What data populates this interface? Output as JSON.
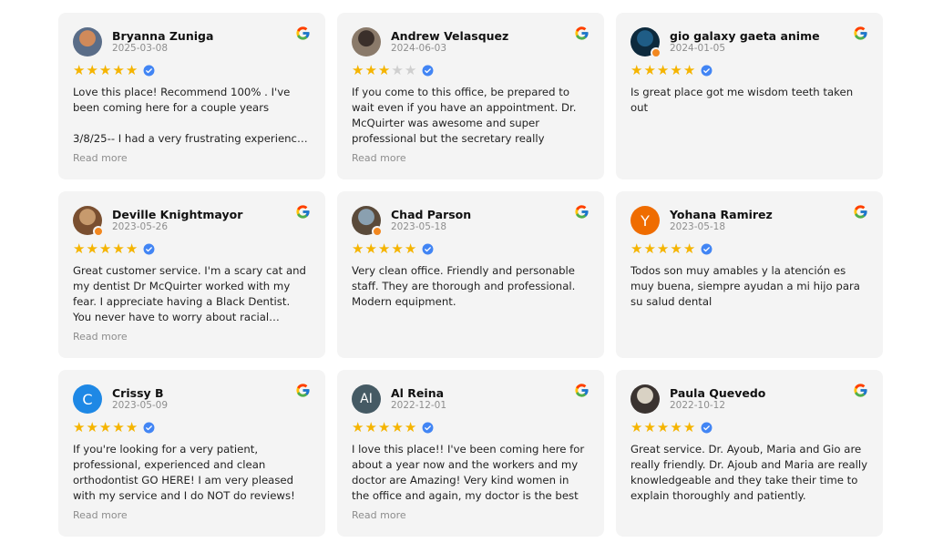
{
  "reviews": [
    {
      "name": "Bryanna Zuniga",
      "date": "2025-03-08",
      "rating": 5,
      "avatar": {
        "type": "photo",
        "color": "#d08a5a",
        "color2": "#5a6d88"
      },
      "text": "Love this place! Recommend 100% . I've been coming here for a couple years\n\n3/8/25-- I had a very frustrating experienc…",
      "more": "Read more"
    },
    {
      "name": "Andrew Velasquez",
      "date": "2024-06-03",
      "rating": 3,
      "avatar": {
        "type": "photo",
        "color": "#3a2f2a",
        "color2": "#8a7a6a"
      },
      "text": "If you come to this office, be prepared to wait even if you have an appointment. Dr. McQuirter was awesome and super professional but the secretary really needs…",
      "more": "Read more"
    },
    {
      "name": "gio galaxy gaeta anime",
      "date": "2024-01-05",
      "rating": 5,
      "avatar": {
        "type": "photo",
        "color": "#1f5d86",
        "color2": "#0d2a3d",
        "badge": true
      },
      "text": "Is great place got me wisdom teeth taken out",
      "more": ""
    },
    {
      "name": "Deville Knightmayor",
      "date": "2023-05-26",
      "rating": 5,
      "avatar": {
        "type": "photo",
        "color": "#c79a6d",
        "color2": "#7a4f30",
        "badge": true
      },
      "text": "Great customer service. I'm a scary cat and my dentist Dr McQuirter worked with my fear. I appreciate having a Black Dentist. You never have to worry about racial…",
      "more": "Read more"
    },
    {
      "name": "Chad Parson",
      "date": "2023-05-18",
      "rating": 5,
      "avatar": {
        "type": "photo",
        "color": "#8aa0b0",
        "color2": "#5a4a3a",
        "badge": true
      },
      "text": "Very clean office. Friendly and personable staff. They are thorough and professional. Modern equipment.",
      "more": ""
    },
    {
      "name": "Yohana Ramirez",
      "date": "2023-05-18",
      "rating": 5,
      "avatar": {
        "type": "letter",
        "letter": "Y",
        "color": "#ef6c00"
      },
      "text": "Todos son muy amables y la atención es muy buena, siempre ayudan a mi hijo para su salud dental",
      "more": ""
    },
    {
      "name": "Crissy B",
      "date": "2023-05-09",
      "rating": 5,
      "avatar": {
        "type": "letter",
        "letter": "C",
        "color": "#1e88e5"
      },
      "text": "If you're looking for a very patient, professional, experienced and clean orthodontist GO HERE! I am very pleased with my service and I do NOT do reviews! B…",
      "more": "Read more"
    },
    {
      "name": "Al Reina",
      "date": "2022-12-01",
      "rating": 5,
      "avatar": {
        "type": "letter",
        "letter": "AI",
        "color": "#455a64"
      },
      "text": "I love this place!! I've been coming here for about a year now and the workers and my doctor are Amazing! Very kind women in the office and again, my doctor is the best in…",
      "more": "Read more"
    },
    {
      "name": "Paula Quevedo",
      "date": "2022-10-12",
      "rating": 5,
      "avatar": {
        "type": "photo",
        "color": "#d9d2c4",
        "color2": "#3a3330"
      },
      "text": "Great service. Dr. Ayoub, Maria and Gio are really friendly. Dr. Ajoub and Maria are really knowledgeable and they take their time to explain thoroughly and patiently.",
      "more": ""
    }
  ],
  "icons": {
    "source": "google-g-icon",
    "verified": "verified-check-icon",
    "star": "star-icon"
  },
  "colors": {
    "star": "#f5b400",
    "star_off": "#cfcfcf",
    "verified": "#4285f4",
    "card_bg": "#f4f4f4"
  }
}
